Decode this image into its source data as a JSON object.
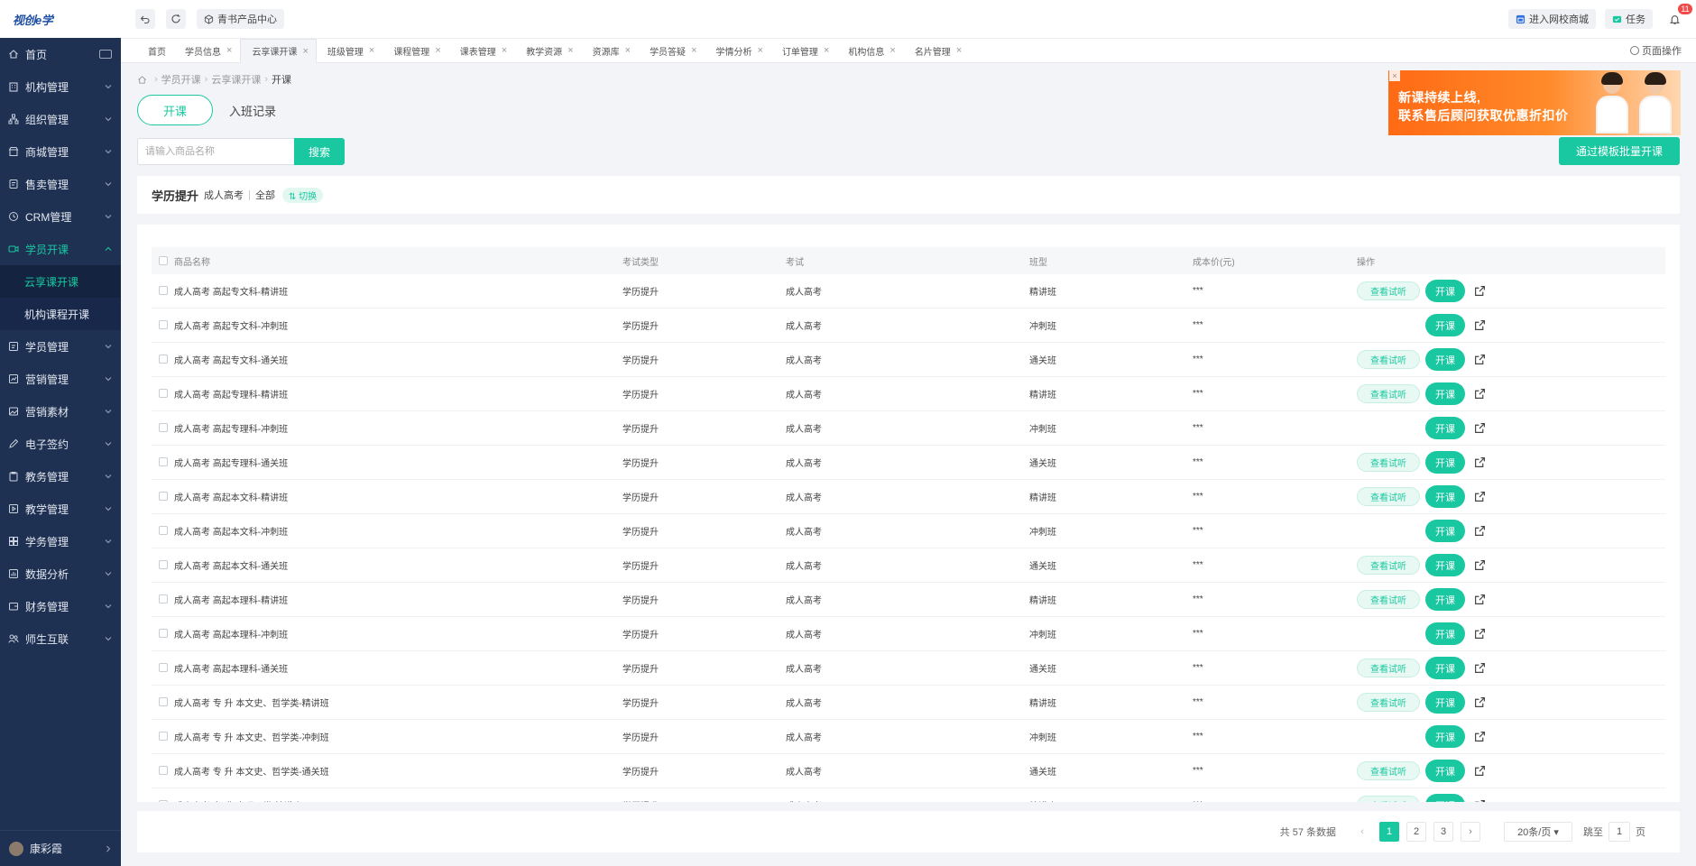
{
  "logo": {
    "text": "视创e学"
  },
  "sidebar": {
    "items": [
      {
        "label": "首页"
      },
      {
        "label": "机构管理"
      },
      {
        "label": "组织管理"
      },
      {
        "label": "商城管理"
      },
      {
        "label": "售卖管理"
      },
      {
        "label": "CRM管理"
      },
      {
        "label": "学员开课"
      },
      {
        "label": "学员管理"
      },
      {
        "label": "营销管理"
      },
      {
        "label": "营销素材"
      },
      {
        "label": "电子签约"
      },
      {
        "label": "教务管理"
      },
      {
        "label": "教学管理"
      },
      {
        "label": "学务管理"
      },
      {
        "label": "数据分析"
      },
      {
        "label": "财务管理"
      },
      {
        "label": "师生互联"
      }
    ],
    "sub_items": [
      {
        "label": "云享课开课"
      },
      {
        "label": "机构课程开课"
      }
    ],
    "user": {
      "name": "康彩霞"
    }
  },
  "topbar": {
    "center_chip": "青书产品中心",
    "shop": "进入网校商城",
    "tasks": "任务",
    "notify_count": "11"
  },
  "tabs": {
    "items": [
      {
        "label": "首页"
      },
      {
        "label": "学员信息"
      },
      {
        "label": "云享课开课"
      },
      {
        "label": "班级管理"
      },
      {
        "label": "课程管理"
      },
      {
        "label": "课表管理"
      },
      {
        "label": "教学资源"
      },
      {
        "label": "资源库"
      },
      {
        "label": "学员答疑"
      },
      {
        "label": "学情分析"
      },
      {
        "label": "订单管理"
      },
      {
        "label": "机构信息"
      },
      {
        "label": "名片管理"
      }
    ],
    "page_ops": "页面操作"
  },
  "breadcrumb": {
    "level1": "学员开课",
    "level2": "云享课开课",
    "current": "开课"
  },
  "page_tabs": {
    "open": "开课",
    "records": "入班记录"
  },
  "search": {
    "placeholder": "请输入商品名称",
    "button": "搜索"
  },
  "ad": {
    "line1": "新课持续上线,",
    "line2": "联系售后顾问获取优惠折扣价"
  },
  "batch_button": "通过模板批量开课",
  "filter": {
    "title": "学历提升",
    "sub1": "成人高考",
    "sub2": "全部",
    "switch": "⇅ 切换"
  },
  "table": {
    "headers": [
      "商品名称",
      "考试类型",
      "考试",
      "班型",
      "成本价(元)",
      "操作"
    ],
    "trial_label": "查看试听",
    "open_label": "开课",
    "rows": [
      {
        "name": "成人高考 高起专文科-精讲班",
        "type": "学历提升",
        "exam": "成人高考",
        "cls": "精讲班",
        "price": "***",
        "trial": true
      },
      {
        "name": "成人高考 高起专文科-冲刺班",
        "type": "学历提升",
        "exam": "成人高考",
        "cls": "冲刺班",
        "price": "***",
        "trial": false
      },
      {
        "name": "成人高考 高起专文科-通关班",
        "type": "学历提升",
        "exam": "成人高考",
        "cls": "通关班",
        "price": "***",
        "trial": true
      },
      {
        "name": "成人高考 高起专理科-精讲班",
        "type": "学历提升",
        "exam": "成人高考",
        "cls": "精讲班",
        "price": "***",
        "trial": true
      },
      {
        "name": "成人高考 高起专理科-冲刺班",
        "type": "学历提升",
        "exam": "成人高考",
        "cls": "冲刺班",
        "price": "***",
        "trial": false
      },
      {
        "name": "成人高考 高起专理科-通关班",
        "type": "学历提升",
        "exam": "成人高考",
        "cls": "通关班",
        "price": "***",
        "trial": true
      },
      {
        "name": "成人高考 高起本文科-精讲班",
        "type": "学历提升",
        "exam": "成人高考",
        "cls": "精讲班",
        "price": "***",
        "trial": true
      },
      {
        "name": "成人高考 高起本文科-冲刺班",
        "type": "学历提升",
        "exam": "成人高考",
        "cls": "冲刺班",
        "price": "***",
        "trial": false
      },
      {
        "name": "成人高考 高起本文科-通关班",
        "type": "学历提升",
        "exam": "成人高考",
        "cls": "通关班",
        "price": "***",
        "trial": true
      },
      {
        "name": "成人高考 高起本理科-精讲班",
        "type": "学历提升",
        "exam": "成人高考",
        "cls": "精讲班",
        "price": "***",
        "trial": true
      },
      {
        "name": "成人高考 高起本理科-冲刺班",
        "type": "学历提升",
        "exam": "成人高考",
        "cls": "冲刺班",
        "price": "***",
        "trial": false
      },
      {
        "name": "成人高考 高起本理科-通关班",
        "type": "学历提升",
        "exam": "成人高考",
        "cls": "通关班",
        "price": "***",
        "trial": true
      },
      {
        "name": "成人高考 专 升 本文史、哲学类-精讲班",
        "type": "学历提升",
        "exam": "成人高考",
        "cls": "精讲班",
        "price": "***",
        "trial": true
      },
      {
        "name": "成人高考 专 升 本文史、哲学类-冲刺班",
        "type": "学历提升",
        "exam": "成人高考",
        "cls": "冲刺班",
        "price": "***",
        "trial": false
      },
      {
        "name": "成人高考 专 升 本文史、哲学类-通关班",
        "type": "学历提升",
        "exam": "成人高考",
        "cls": "通关班",
        "price": "***",
        "trial": true
      },
      {
        "name": "成人高考 专 升 本理工类-精讲班",
        "type": "学历提升",
        "exam": "成人高考",
        "cls": "精讲班",
        "price": "***",
        "trial": true
      }
    ]
  },
  "pagination": {
    "total": "共 57 条数据",
    "pages": [
      "1",
      "2",
      "3"
    ],
    "page_size": "20条/页 ▾",
    "jump_label": "跳至",
    "jump_value": "1",
    "page_unit": "页"
  },
  "colors": {
    "accent": "#19c8a0",
    "sidebar_bg": "#1f3152",
    "ad_orange": "#ff6a14"
  }
}
